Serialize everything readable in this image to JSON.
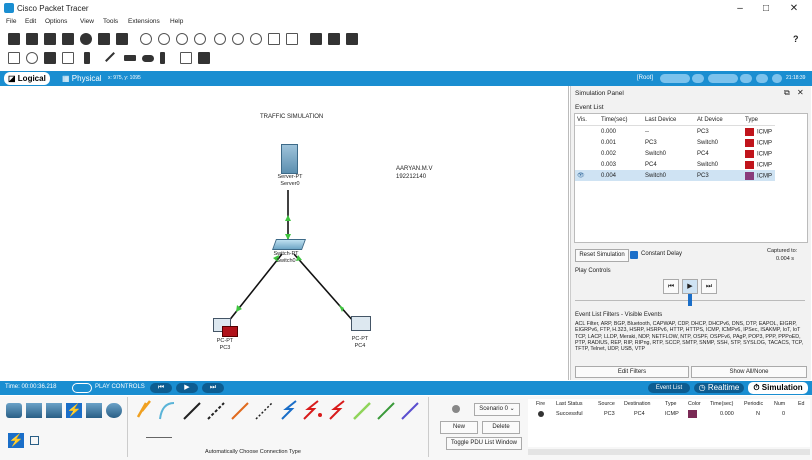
{
  "app": {
    "title": "Cisco Packet Tracer",
    "help": "?"
  },
  "menu": [
    "File",
    "Edit",
    "Options",
    "View",
    "Tools",
    "Extensions",
    "Help"
  ],
  "workspace": {
    "logical": "Logical",
    "physical": "Physical",
    "coords": "x: 975, y: 1095",
    "root": "[Root]",
    "clock": "21:18:39"
  },
  "canvas": {
    "title": "TRAFFIC SIMULATION",
    "note_name": "AARYAN.M.V",
    "note_id": "192212140",
    "server_type": "Server-PT",
    "server_name": "Server0",
    "switch_type": "Switch-PT",
    "switch_name": "Switch0",
    "pc3_type": "PC-PT",
    "pc3_name": "PC3",
    "pc4_type": "PC-PT",
    "pc4_name": "PC4"
  },
  "sim": {
    "panel_title": "Simulation Panel",
    "event_list_label": "Event List",
    "headers": [
      "Vis.",
      "Time(sec)",
      "Last Device",
      "At Device",
      "Type"
    ],
    "events": [
      {
        "time": "0.000",
        "last": "--",
        "at": "PC3",
        "type": "ICMP",
        "color": "#c0141b"
      },
      {
        "time": "0.001",
        "last": "PC3",
        "at": "Switch0",
        "type": "ICMP",
        "color": "#c0141b"
      },
      {
        "time": "0.002",
        "last": "Switch0",
        "at": "PC4",
        "type": "ICMP",
        "color": "#c0141b"
      },
      {
        "time": "0.003",
        "last": "PC4",
        "at": "Switch0",
        "type": "ICMP",
        "color": "#c0141b"
      },
      {
        "time": "0.004",
        "last": "Switch0",
        "at": "PC3",
        "type": "ICMP",
        "color": "#8a3b7a"
      }
    ],
    "reset": "Reset Simulation",
    "constant_delay": "Constant Delay",
    "captured_label": "Captured to:",
    "captured_value": "0.004 s",
    "play_controls": "Play Controls",
    "filters_title": "Event List Filters - Visible Events",
    "filters_text": "ACL Filter, ARP, BGP, Bluetooth, CAPWAP, CDP, DHCP, DHCPv6, DNS, DTP, EAPOL, EIGRP, EIGRPv6, FTP, H.323, HSRP, HSRPv6, HTTP, HTTPS, ICMP, ICMPv6, IPSec, ISAKMP, IoT, IoT TCP, LACP, LLDP, Meraki, NDP, NETFLOW, NTP, OSPF, OSPFv6, PAgP, POP3, PPP, PPPoED, PTP, RADIUS, REP, RIP, RIPng, RTP, SCCP, SMTP, SNMP, SSH, STP, SYSLOG, TACACS, TCP, TFTP, Telnet, UDP, USB, VTP",
    "edit_filters": "Edit Filters",
    "show_all": "Show All/None"
  },
  "timebar": {
    "time": "Time: 00:00:36.218",
    "play_controls": "PLAY CONTROLS",
    "event_list": "Event List",
    "realtime": "Realtime",
    "simulation": "Simulation"
  },
  "bottom": {
    "auto_connection": "Automatically Choose Connection Type",
    "scenario": "Scenario 0",
    "new": "New",
    "delete": "Delete",
    "toggle": "Toggle PDU List Window",
    "pdu_headers": [
      "Fire",
      "Last Status",
      "Source",
      "Destination",
      "Type",
      "Color",
      "Time(sec)",
      "Periodic",
      "Num",
      "Ed"
    ],
    "pdu_row": {
      "status": "Successful",
      "source": "PC3",
      "dest": "PC4",
      "type": "ICMP",
      "color": "#7a2a55",
      "time": "0.000",
      "periodic": "N",
      "num": "0"
    }
  }
}
